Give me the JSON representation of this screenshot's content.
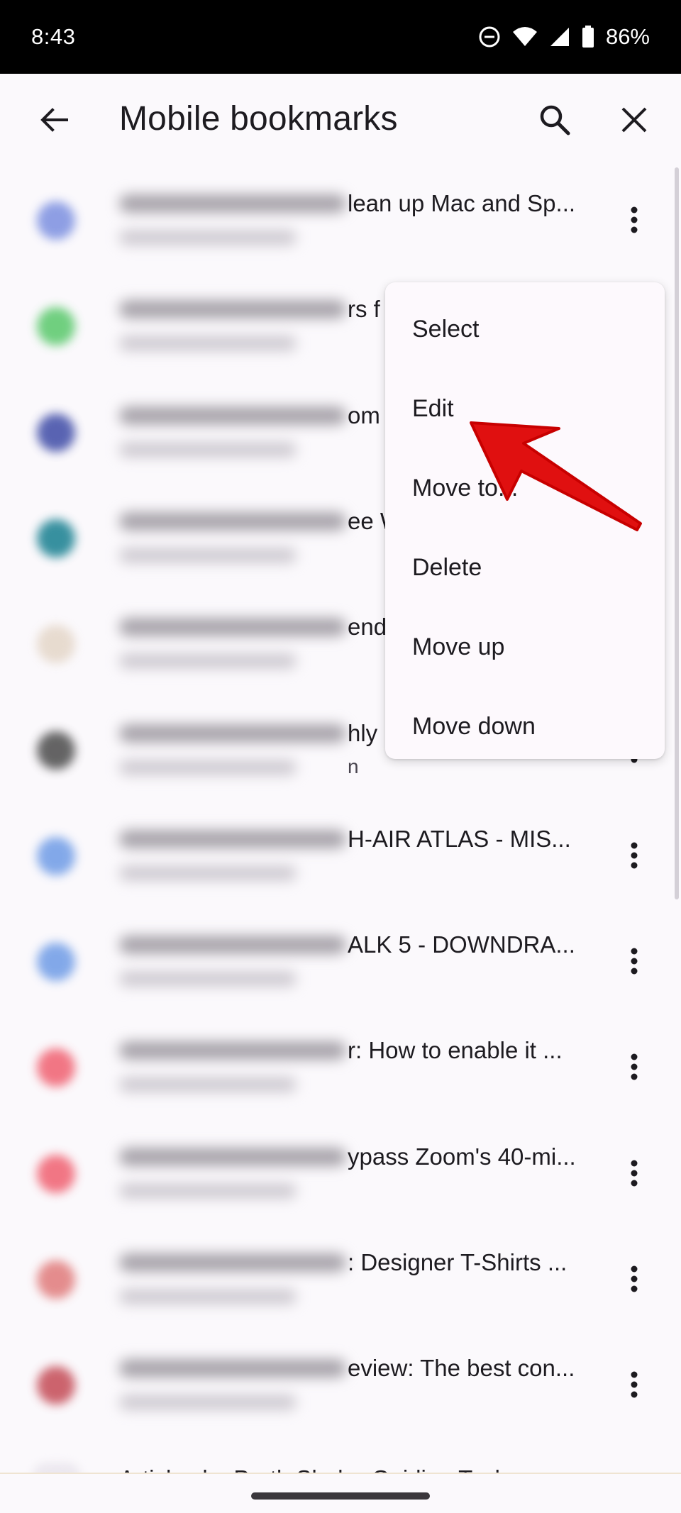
{
  "status_bar": {
    "time": "8:43",
    "battery_percent": "86%",
    "icons": [
      "do-not-disturb-icon",
      "wifi-icon",
      "cell-signal-icon",
      "battery-icon"
    ]
  },
  "app_bar": {
    "title": "Mobile bookmarks",
    "icons": [
      "back-arrow-icon",
      "search-icon",
      "close-icon"
    ]
  },
  "bookmarks": [
    {
      "title_visible": "lean up Mac and Sp...",
      "url_visible": "",
      "favicon_color": "#7b8fe0"
    },
    {
      "title_visible": "rs f",
      "url_visible": "",
      "favicon_color": "#58c86a"
    },
    {
      "title_visible": "om",
      "url_visible": "",
      "favicon_color": "#3d4aa6"
    },
    {
      "title_visible": "ee W",
      "url_visible": "",
      "favicon_color": "#157e8f"
    },
    {
      "title_visible": "end",
      "url_visible": "",
      "favicon_color": "#e4d6c8"
    },
    {
      "title_visible": "hly",
      "url_visible": "n",
      "favicon_color": "#4a4a4a"
    },
    {
      "title_visible": "H-AIR ATLAS - MIS...",
      "url_visible": "",
      "favicon_color": "#6e9be6"
    },
    {
      "title_visible": "ALK 5 - DOWNDRA...",
      "url_visible": "",
      "favicon_color": "#6e9be6"
    },
    {
      "title_visible": "r: How to enable it ...",
      "url_visible": "",
      "favicon_color": "#f06070"
    },
    {
      "title_visible": "ypass Zoom's 40-mi...",
      "url_visible": "",
      "favicon_color": "#f06070"
    },
    {
      "title_visible": ": Designer T-Shirts ...",
      "url_visible": "",
      "favicon_color": "#e07a7a"
    },
    {
      "title_visible": "eview: The best con...",
      "url_visible": "",
      "favicon_color": "#c44a55"
    }
  ],
  "partial_row": {
    "title": "Articles by Parth Shah - Guiding Tech"
  },
  "menu": {
    "items": [
      "Select",
      "Edit",
      "Move to...",
      "Delete",
      "Move up",
      "Move down"
    ]
  },
  "annotation": {
    "arrow_color": "#e01010",
    "points_to": "Edit"
  },
  "colors": {
    "background": "#fbf9fc",
    "menu_bg": "#fdf9fd",
    "text": "#1d1b20"
  }
}
